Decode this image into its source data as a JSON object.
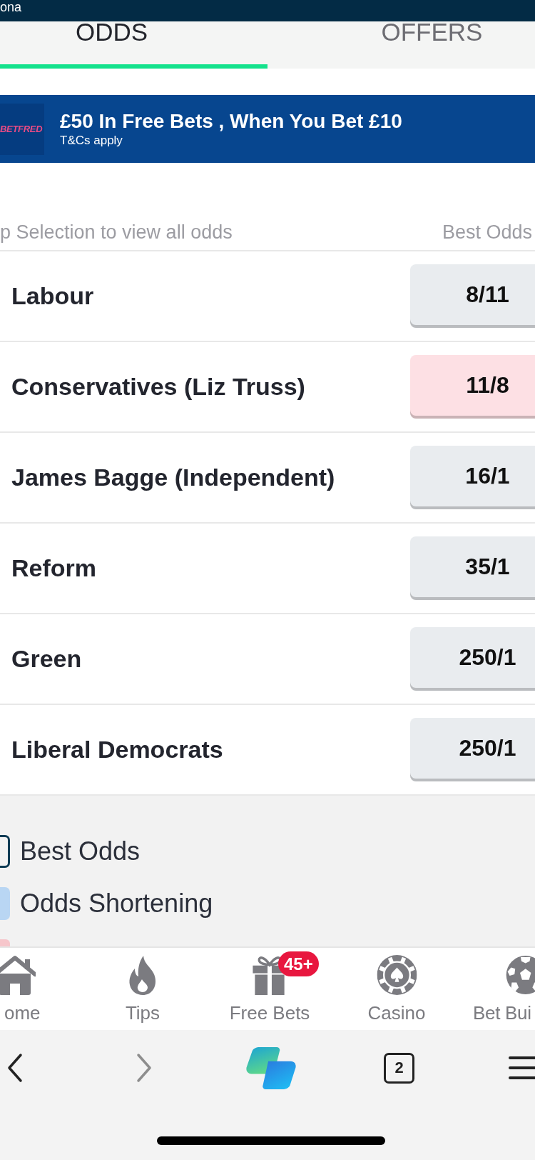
{
  "app_header": {
    "title": "ona"
  },
  "tabs": [
    {
      "label": "ODDS",
      "selected": true
    },
    {
      "label": "OFFERS",
      "selected": false
    }
  ],
  "promo_banner": {
    "logo": "BETFRED",
    "title": "£50 In Free Bets , When You Bet £10",
    "terms": "T&Cs apply"
  },
  "odds_table": {
    "hint": "p Selection to view all odds",
    "column_heading": "Best Odds",
    "rows": [
      {
        "name": "Labour",
        "odds": "8/11",
        "color": "#e9ecef"
      },
      {
        "name": "Conservatives (Liz Truss)",
        "odds": "11/8",
        "color": "#fde0e4"
      },
      {
        "name": "James Bagge (Independent)",
        "odds": "16/1",
        "color": "#e9ecef"
      },
      {
        "name": "Reform",
        "odds": "35/1",
        "color": "#e9ecef"
      },
      {
        "name": "Green",
        "odds": "250/1",
        "color": "#e9ecef"
      },
      {
        "name": "Liberal Democrats",
        "odds": "250/1",
        "color": "#e9ecef"
      }
    ]
  },
  "legend": [
    {
      "kind": "outline",
      "label": "Best Odds",
      "color": "#0e3b54"
    },
    {
      "kind": "fill",
      "label": "Odds Shortening",
      "color": "#b9d6f3"
    },
    {
      "kind": "fill",
      "color": "#f6c6cb"
    }
  ],
  "bottom_nav": [
    {
      "kind": "home",
      "label": "ome"
    },
    {
      "kind": "flame",
      "label": "Tips"
    },
    {
      "kind": "gift",
      "label": "Free Bets",
      "badge": "45+"
    },
    {
      "kind": "chip",
      "label": "Casino"
    },
    {
      "kind": "ball",
      "label": "Bet Bui"
    }
  ],
  "browser_toolbar": [
    {
      "kind": "back",
      "disabled": false
    },
    {
      "kind": "forward",
      "disabled": true
    },
    {
      "kind": "assistant"
    },
    {
      "kind": "tabs",
      "count": "2"
    },
    {
      "kind": "menu"
    }
  ]
}
